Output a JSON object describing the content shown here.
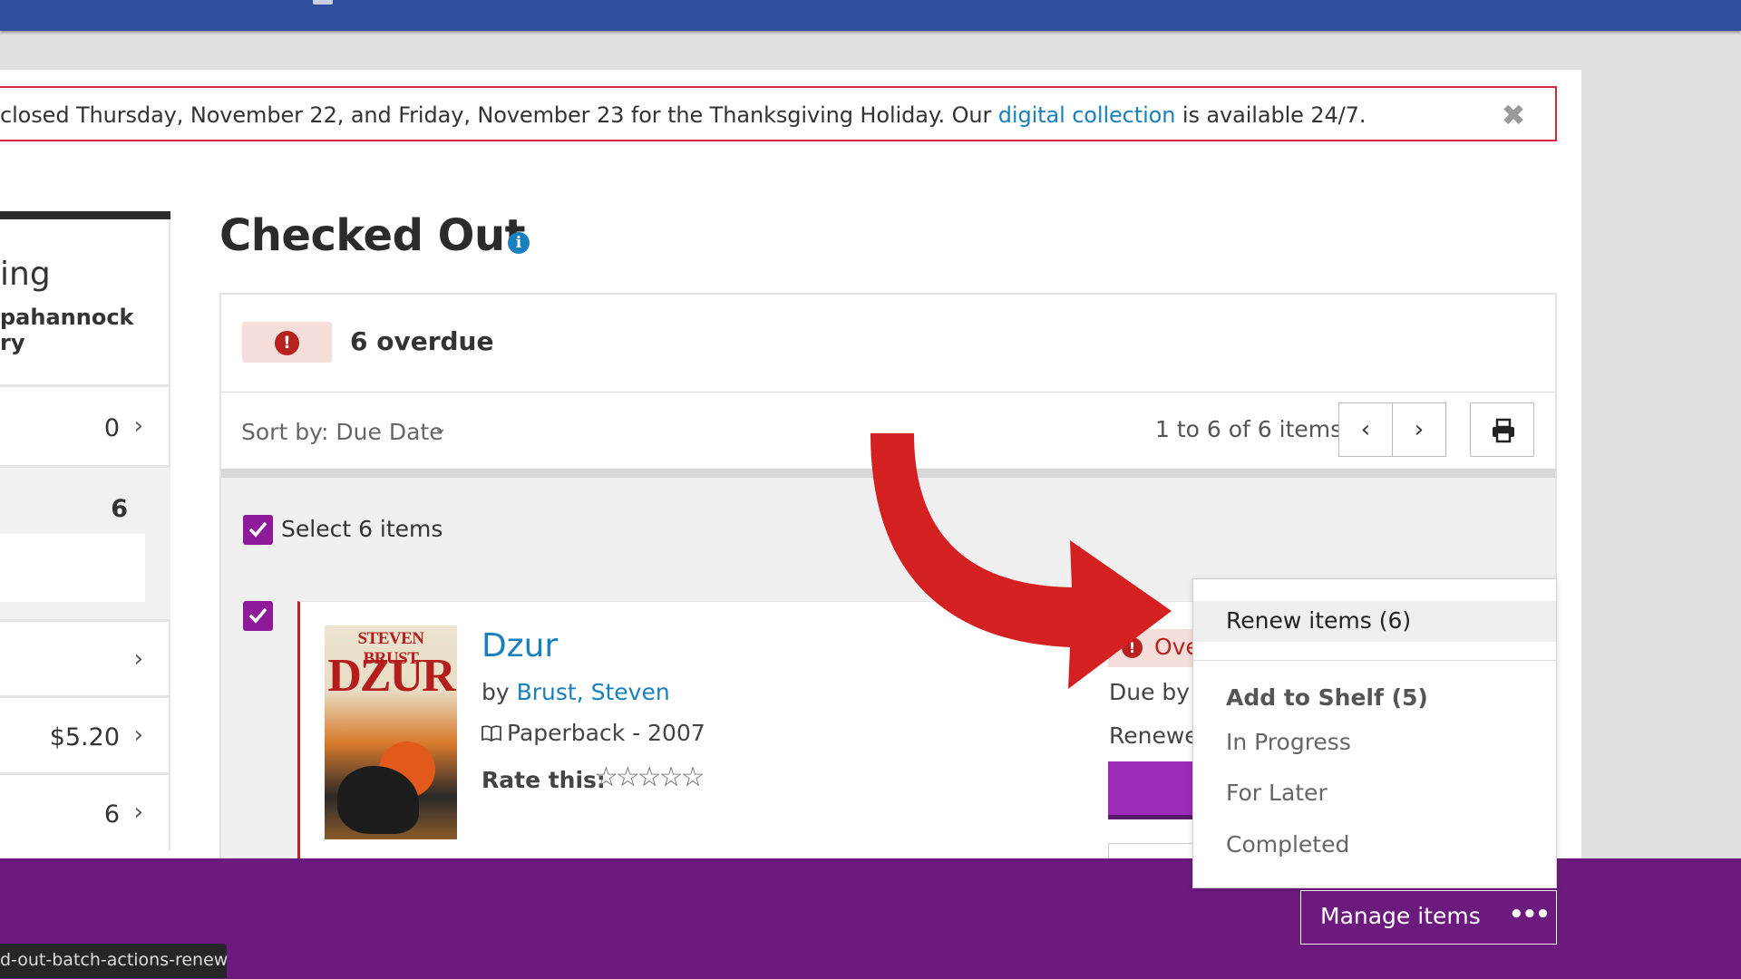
{
  "alert": {
    "text_before": "closed Thursday, November 22, and Friday, November 23 for the Thanksgiving Holiday. Our ",
    "link": "digital collection",
    "text_after": " is available 24/7.",
    "close_icon": "close-icon"
  },
  "sidebar": {
    "title": "ing",
    "library_line1": "pahannock",
    "library_line2": "ry",
    "rows": [
      {
        "value": "0",
        "chevron": "›"
      },
      {
        "value": "6",
        "chevron": ""
      },
      {
        "value": "",
        "chevron": "›"
      },
      {
        "value": "$5.20",
        "chevron": "›"
      },
      {
        "value": "6",
        "chevron": "›"
      }
    ]
  },
  "main": {
    "title": "Checked Out",
    "info_icon": "i",
    "overdue_icon": "!",
    "overdue_label": "6 overdue",
    "sort_label": "Sort by: Due Date",
    "sort_chevron": "⌄",
    "pager_text": "1 to 6 of 6 items",
    "prev": "‹",
    "next": "›",
    "select_all_label": "Select 6 items"
  },
  "item": {
    "cover_author": "STEVEN BRUST",
    "cover_title": "DZUR",
    "title": "Dzur",
    "by": "by ",
    "author": "Brust, Steven",
    "format": "Paperback - 2007",
    "rate_label": "Rate this:",
    "stars": "☆☆☆☆☆",
    "status_icon": "!",
    "status": "Ove",
    "due": "Due by N",
    "renewed": "Renewe"
  },
  "dropdown": {
    "renew": "Renew items (6)",
    "shelf_heading": "Add to Shelf (5)",
    "items": [
      "In Progress",
      "For Later",
      "Completed"
    ]
  },
  "footer": {
    "manage_label": "Manage items",
    "manage_dots": "•••"
  },
  "status_bar": {
    "url": "d-out-batch-actions-renew"
  },
  "colors": {
    "topbar": "#2e4f9e",
    "footer": "#6d1a7e",
    "checkbox": "#8e1a9a",
    "link": "#1a7fbd",
    "overdue": "#b8221e",
    "arrow": "#d42020"
  }
}
